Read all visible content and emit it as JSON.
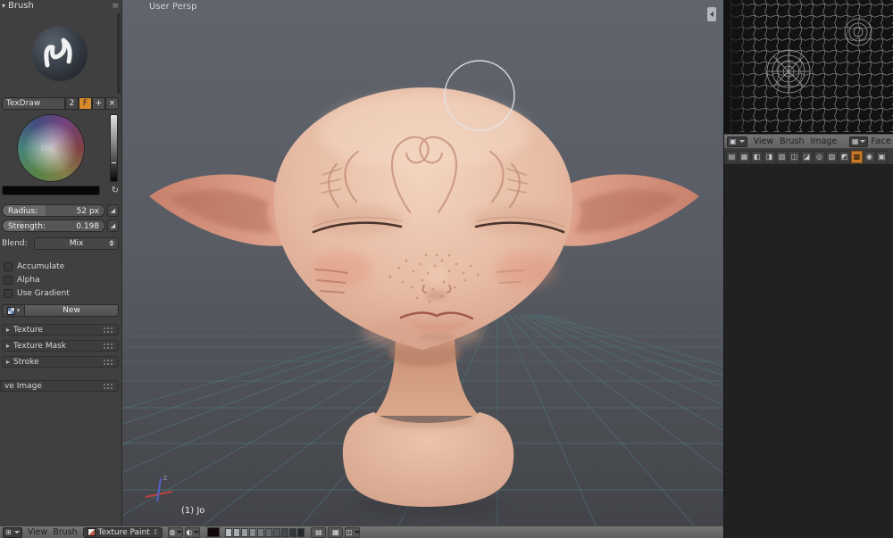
{
  "colors": {
    "accent_orange": "#d98a2b",
    "grid_teal": "#4e7f85",
    "panel_gray": "#404040",
    "header_gray": "#6b6b6b",
    "viewport_top": "#60646d",
    "viewport_bottom": "#424449",
    "skin_base": "#e7bba4",
    "active_tool": "#c87a2c"
  },
  "left_panel": {
    "menu_icon": "≡",
    "expand_icon": "▾",
    "collapse_icon": "▸",
    "brush_header": "Brush",
    "datablock": {
      "name": "TexDraw",
      "users": "2",
      "fake_user": "F",
      "add": "+",
      "unlink": "×"
    },
    "color_swap_icon": "↻",
    "radius": {
      "label": "Radius:",
      "value": "52 px"
    },
    "strength": {
      "label": "Strength:",
      "value": "0.198"
    },
    "pressure_icon": "◢",
    "blend": {
      "label": "Blend:",
      "value": "Mix"
    },
    "options": [
      {
        "label": "Accumulate",
        "checked": false
      },
      {
        "label": "Alpha",
        "checked": false
      },
      {
        "label": "Use Gradient",
        "checked": false
      }
    ],
    "texture": {
      "browse_icon": "▾",
      "new_button": "New"
    },
    "sections": [
      {
        "label": "Texture"
      },
      {
        "label": "Texture Mask"
      },
      {
        "label": "Stroke"
      }
    ],
    "save_section": {
      "label": "ve Image"
    }
  },
  "viewport": {
    "view_label": "User Persp",
    "object_label": "(1) Jo"
  },
  "image_editor": {
    "editor_icon": "▣",
    "menus": [
      {
        "label": "View"
      },
      {
        "label": "Brush"
      },
      {
        "label": "Image"
      }
    ],
    "mode": {
      "icon": "▦",
      "label": "Face"
    },
    "tools": [
      {
        "name": "image-icon",
        "glyph": "▤"
      },
      {
        "name": "uv-grid-icon",
        "glyph": "▦"
      },
      {
        "name": "paint-slot-icon",
        "glyph": "◧"
      },
      {
        "name": "mask-icon",
        "glyph": "◨"
      },
      {
        "name": "shade-icon",
        "glyph": "▧"
      },
      {
        "name": "mirror-icon",
        "glyph": "◫"
      },
      {
        "name": "clone-icon",
        "glyph": "◪"
      },
      {
        "name": "soften-icon",
        "glyph": "◎"
      },
      {
        "name": "smear-icon",
        "glyph": "▨"
      },
      {
        "name": "stencil-icon",
        "glyph": "◩"
      },
      {
        "name": "fill-icon",
        "glyph": "▩",
        "active": true
      },
      {
        "name": "dot-icon",
        "glyph": "◉"
      },
      {
        "name": "pin-icon",
        "glyph": "▣"
      }
    ]
  },
  "bottom_bar": {
    "editor_icon": "⊞",
    "menus": [
      {
        "label": "View"
      },
      {
        "label": "Brush"
      }
    ],
    "mode": {
      "label": "Texture Paint",
      "arrows": "↕"
    },
    "tools": [
      {
        "name": "brush-preview-icon",
        "glyph": "◍",
        "dropdown": true
      },
      {
        "name": "falloff-icon",
        "glyph": "◐",
        "dropdown": true
      }
    ],
    "palette": [
      "#b9bdc2",
      "#a8adb3",
      "#979ca3",
      "#868b92",
      "#757a81",
      "#646970",
      "#53585f",
      "#42474d",
      "#32363b",
      "#23262a"
    ],
    "right_tools": [
      {
        "name": "symmetry-icon",
        "glyph": "▤"
      },
      {
        "name": "grid-icon",
        "glyph": "▦"
      },
      {
        "name": "options-icon",
        "glyph": "◫",
        "dropdown": true
      }
    ]
  }
}
